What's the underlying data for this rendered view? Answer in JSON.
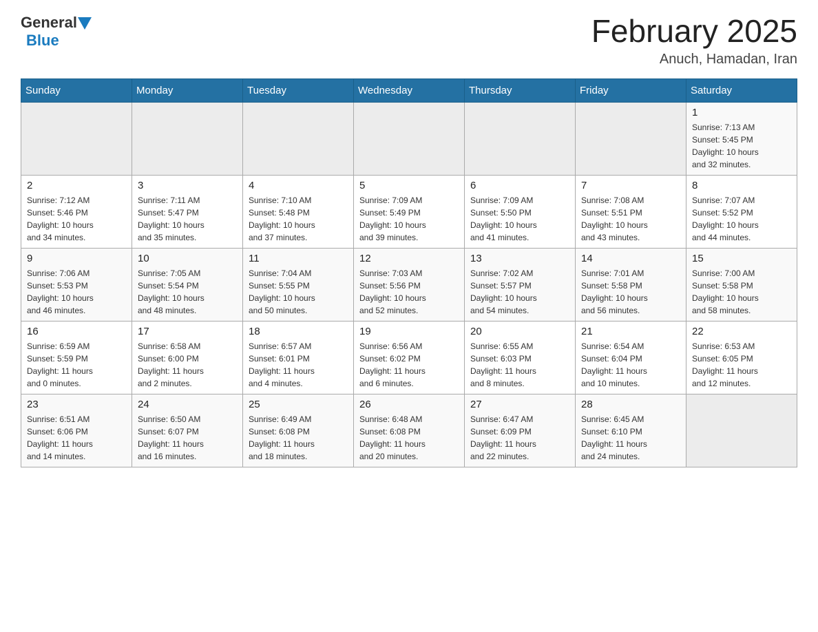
{
  "header": {
    "logo": {
      "general": "General",
      "blue": "Blue",
      "arrow": "▲"
    },
    "title": "February 2025",
    "location": "Anuch, Hamadan, Iran"
  },
  "calendar": {
    "days_of_week": [
      "Sunday",
      "Monday",
      "Tuesday",
      "Wednesday",
      "Thursday",
      "Friday",
      "Saturday"
    ],
    "weeks": [
      [
        {
          "day": "",
          "info": ""
        },
        {
          "day": "",
          "info": ""
        },
        {
          "day": "",
          "info": ""
        },
        {
          "day": "",
          "info": ""
        },
        {
          "day": "",
          "info": ""
        },
        {
          "day": "",
          "info": ""
        },
        {
          "day": "1",
          "info": "Sunrise: 7:13 AM\nSunset: 5:45 PM\nDaylight: 10 hours\nand 32 minutes."
        }
      ],
      [
        {
          "day": "2",
          "info": "Sunrise: 7:12 AM\nSunset: 5:46 PM\nDaylight: 10 hours\nand 34 minutes."
        },
        {
          "day": "3",
          "info": "Sunrise: 7:11 AM\nSunset: 5:47 PM\nDaylight: 10 hours\nand 35 minutes."
        },
        {
          "day": "4",
          "info": "Sunrise: 7:10 AM\nSunset: 5:48 PM\nDaylight: 10 hours\nand 37 minutes."
        },
        {
          "day": "5",
          "info": "Sunrise: 7:09 AM\nSunset: 5:49 PM\nDaylight: 10 hours\nand 39 minutes."
        },
        {
          "day": "6",
          "info": "Sunrise: 7:09 AM\nSunset: 5:50 PM\nDaylight: 10 hours\nand 41 minutes."
        },
        {
          "day": "7",
          "info": "Sunrise: 7:08 AM\nSunset: 5:51 PM\nDaylight: 10 hours\nand 43 minutes."
        },
        {
          "day": "8",
          "info": "Sunrise: 7:07 AM\nSunset: 5:52 PM\nDaylight: 10 hours\nand 44 minutes."
        }
      ],
      [
        {
          "day": "9",
          "info": "Sunrise: 7:06 AM\nSunset: 5:53 PM\nDaylight: 10 hours\nand 46 minutes."
        },
        {
          "day": "10",
          "info": "Sunrise: 7:05 AM\nSunset: 5:54 PM\nDaylight: 10 hours\nand 48 minutes."
        },
        {
          "day": "11",
          "info": "Sunrise: 7:04 AM\nSunset: 5:55 PM\nDaylight: 10 hours\nand 50 minutes."
        },
        {
          "day": "12",
          "info": "Sunrise: 7:03 AM\nSunset: 5:56 PM\nDaylight: 10 hours\nand 52 minutes."
        },
        {
          "day": "13",
          "info": "Sunrise: 7:02 AM\nSunset: 5:57 PM\nDaylight: 10 hours\nand 54 minutes."
        },
        {
          "day": "14",
          "info": "Sunrise: 7:01 AM\nSunset: 5:58 PM\nDaylight: 10 hours\nand 56 minutes."
        },
        {
          "day": "15",
          "info": "Sunrise: 7:00 AM\nSunset: 5:58 PM\nDaylight: 10 hours\nand 58 minutes."
        }
      ],
      [
        {
          "day": "16",
          "info": "Sunrise: 6:59 AM\nSunset: 5:59 PM\nDaylight: 11 hours\nand 0 minutes."
        },
        {
          "day": "17",
          "info": "Sunrise: 6:58 AM\nSunset: 6:00 PM\nDaylight: 11 hours\nand 2 minutes."
        },
        {
          "day": "18",
          "info": "Sunrise: 6:57 AM\nSunset: 6:01 PM\nDaylight: 11 hours\nand 4 minutes."
        },
        {
          "day": "19",
          "info": "Sunrise: 6:56 AM\nSunset: 6:02 PM\nDaylight: 11 hours\nand 6 minutes."
        },
        {
          "day": "20",
          "info": "Sunrise: 6:55 AM\nSunset: 6:03 PM\nDaylight: 11 hours\nand 8 minutes."
        },
        {
          "day": "21",
          "info": "Sunrise: 6:54 AM\nSunset: 6:04 PM\nDaylight: 11 hours\nand 10 minutes."
        },
        {
          "day": "22",
          "info": "Sunrise: 6:53 AM\nSunset: 6:05 PM\nDaylight: 11 hours\nand 12 minutes."
        }
      ],
      [
        {
          "day": "23",
          "info": "Sunrise: 6:51 AM\nSunset: 6:06 PM\nDaylight: 11 hours\nand 14 minutes."
        },
        {
          "day": "24",
          "info": "Sunrise: 6:50 AM\nSunset: 6:07 PM\nDaylight: 11 hours\nand 16 minutes."
        },
        {
          "day": "25",
          "info": "Sunrise: 6:49 AM\nSunset: 6:08 PM\nDaylight: 11 hours\nand 18 minutes."
        },
        {
          "day": "26",
          "info": "Sunrise: 6:48 AM\nSunset: 6:08 PM\nDaylight: 11 hours\nand 20 minutes."
        },
        {
          "day": "27",
          "info": "Sunrise: 6:47 AM\nSunset: 6:09 PM\nDaylight: 11 hours\nand 22 minutes."
        },
        {
          "day": "28",
          "info": "Sunrise: 6:45 AM\nSunset: 6:10 PM\nDaylight: 11 hours\nand 24 minutes."
        },
        {
          "day": "",
          "info": ""
        }
      ]
    ]
  }
}
